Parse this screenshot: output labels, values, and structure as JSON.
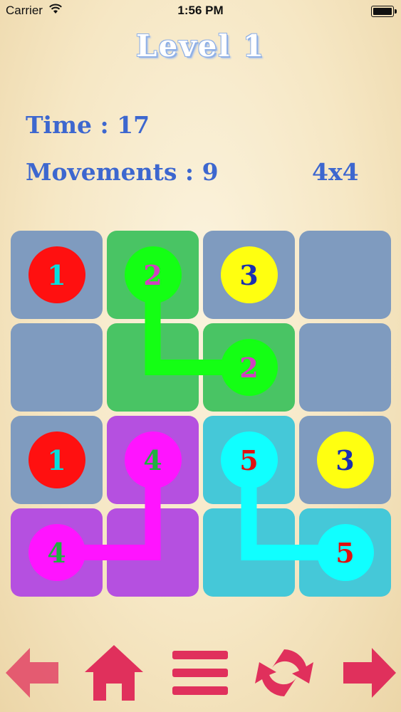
{
  "status_bar": {
    "carrier": "Carrier",
    "time": "1:56 PM"
  },
  "header": {
    "title": "Level 1",
    "time_label": "Time : 17",
    "movements_label": "Movements : 9",
    "grid_size": "4x4"
  },
  "board": {
    "rows": 4,
    "cols": 4,
    "cell_colors": [
      [
        "#7f9bbf",
        "#49c464",
        "#7f9bbf",
        "#7f9bbf"
      ],
      [
        "#7f9bbf",
        "#49c464",
        "#49c464",
        "#7f9bbf"
      ],
      [
        "#7f9bbf",
        "#b550e0",
        "#45c8d8",
        "#7f9bbf"
      ],
      [
        "#b550e0",
        "#b550e0",
        "#45c8d8",
        "#45c8d8"
      ]
    ],
    "dots": [
      {
        "row": 0,
        "col": 0,
        "label": "1",
        "fill": "#ff1010",
        "text_color": "#00e0e0"
      },
      {
        "row": 0,
        "col": 1,
        "label": "2",
        "fill": "#14ff14",
        "text_color": "#d040c0"
      },
      {
        "row": 0,
        "col": 2,
        "label": "3",
        "fill": "#ffff10",
        "text_color": "#1a2fb0"
      },
      {
        "row": 1,
        "col": 2,
        "label": "2",
        "fill": "#14ff14",
        "text_color": "#d040c0"
      },
      {
        "row": 2,
        "col": 0,
        "label": "1",
        "fill": "#ff1010",
        "text_color": "#00e0e0"
      },
      {
        "row": 2,
        "col": 1,
        "label": "4",
        "fill": "#ff14ff",
        "text_color": "#20b040"
      },
      {
        "row": 2,
        "col": 2,
        "label": "5",
        "fill": "#10ffff",
        "text_color": "#e01010"
      },
      {
        "row": 2,
        "col": 3,
        "label": "3",
        "fill": "#ffff10",
        "text_color": "#1a2fb0"
      },
      {
        "row": 3,
        "col": 0,
        "label": "4",
        "fill": "#ff14ff",
        "text_color": "#20b040"
      },
      {
        "row": 3,
        "col": 3,
        "label": "5",
        "fill": "#10ffff",
        "text_color": "#e01010"
      }
    ],
    "paths": [
      {
        "color": "#14ff14",
        "cells": [
          [
            0,
            1
          ],
          [
            1,
            1
          ],
          [
            1,
            2
          ]
        ]
      },
      {
        "color": "#ff14ff",
        "cells": [
          [
            2,
            1
          ],
          [
            3,
            1
          ],
          [
            3,
            0
          ]
        ]
      },
      {
        "color": "#10ffff",
        "cells": [
          [
            2,
            2
          ],
          [
            3,
            2
          ],
          [
            3,
            3
          ]
        ]
      }
    ]
  },
  "toolbar": {
    "color": "#e0305c",
    "buttons": [
      {
        "icon": "back-arrow-icon"
      },
      {
        "icon": "home-icon"
      },
      {
        "icon": "menu-icon"
      },
      {
        "icon": "refresh-icon"
      },
      {
        "icon": "forward-arrow-icon"
      }
    ]
  }
}
